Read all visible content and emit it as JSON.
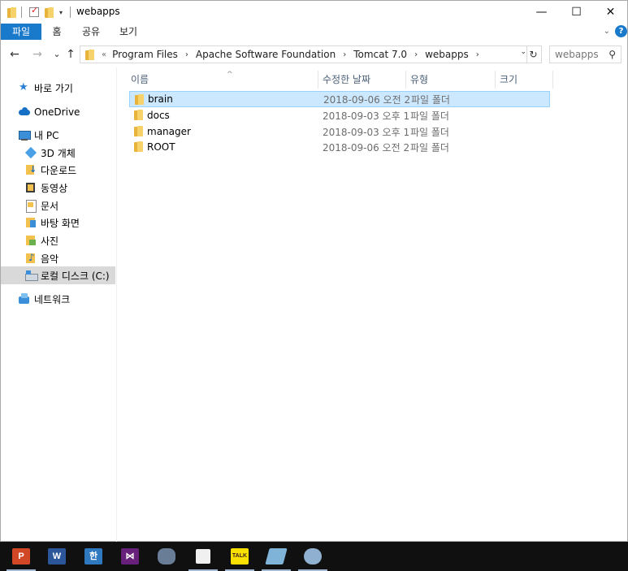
{
  "window": {
    "title": "webapps",
    "minimize": "—",
    "maximize": "☐",
    "close": "✕"
  },
  "ribbon": {
    "tabs": [
      "파일",
      "홈",
      "공유",
      "보기"
    ],
    "help": "?"
  },
  "nav": {
    "back": "←",
    "forward": "→",
    "recent": "⌄",
    "up": "↑",
    "path": [
      "Program Files",
      "Apache Software Foundation",
      "Tomcat 7.0",
      "webapps"
    ],
    "search_placeholder": "webapps"
  },
  "sidebar": {
    "items": [
      {
        "label": "바로 가기",
        "icon": "star-icon"
      },
      {
        "label": "OneDrive",
        "icon": "cloud-icon"
      },
      {
        "label": "내 PC",
        "icon": "pc-icon"
      },
      {
        "label": "3D 개체",
        "icon": "3d-objects-icon"
      },
      {
        "label": "다운로드",
        "icon": "downloads-icon"
      },
      {
        "label": "동영상",
        "icon": "videos-icon"
      },
      {
        "label": "문서",
        "icon": "documents-icon"
      },
      {
        "label": "바탕 화면",
        "icon": "desktop-icon"
      },
      {
        "label": "사진",
        "icon": "pictures-icon"
      },
      {
        "label": "음악",
        "icon": "music-icon"
      },
      {
        "label": "로컬 디스크 (C:)",
        "icon": "local-disk-icon"
      },
      {
        "label": "네트워크",
        "icon": "network-icon"
      }
    ]
  },
  "columns": {
    "name": "이름",
    "modified": "수정한 날짜",
    "type": "유형",
    "size": "크기"
  },
  "files": [
    {
      "name": "brain",
      "modified": "2018-09-06 오전 2",
      "type": "파일 폴더",
      "selected": true
    },
    {
      "name": "docs",
      "modified": "2018-09-03 오후 1",
      "type": "파일 폴더"
    },
    {
      "name": "manager",
      "modified": "2018-09-03 오후 1",
      "type": "파일 폴더"
    },
    {
      "name": "ROOT",
      "modified": "2018-09-06 오전 2",
      "type": "파일 폴더"
    }
  ],
  "taskbar": {
    "apps": [
      {
        "name": "powerpoint-icon",
        "label": "P",
        "color": "#d24726"
      },
      {
        "name": "word-icon",
        "label": "W",
        "color": "#2b579a"
      },
      {
        "name": "hangul-icon",
        "label": "한",
        "color": "#2f79c1"
      },
      {
        "name": "visual-studio-icon",
        "label": "⋈",
        "color": "#68217a"
      },
      {
        "name": "database-icon",
        "label": "",
        "color": "#6a7d96"
      },
      {
        "name": "sticky-notes-icon",
        "label": "",
        "color": "#f0f0f0"
      },
      {
        "name": "kakaotalk-icon",
        "label": "TALK",
        "color": "#f9e000"
      },
      {
        "name": "notepad-icon",
        "label": "",
        "color": "#7fb4d8"
      },
      {
        "name": "paint-icon",
        "label": "",
        "color": "#8fb0d0"
      }
    ]
  }
}
